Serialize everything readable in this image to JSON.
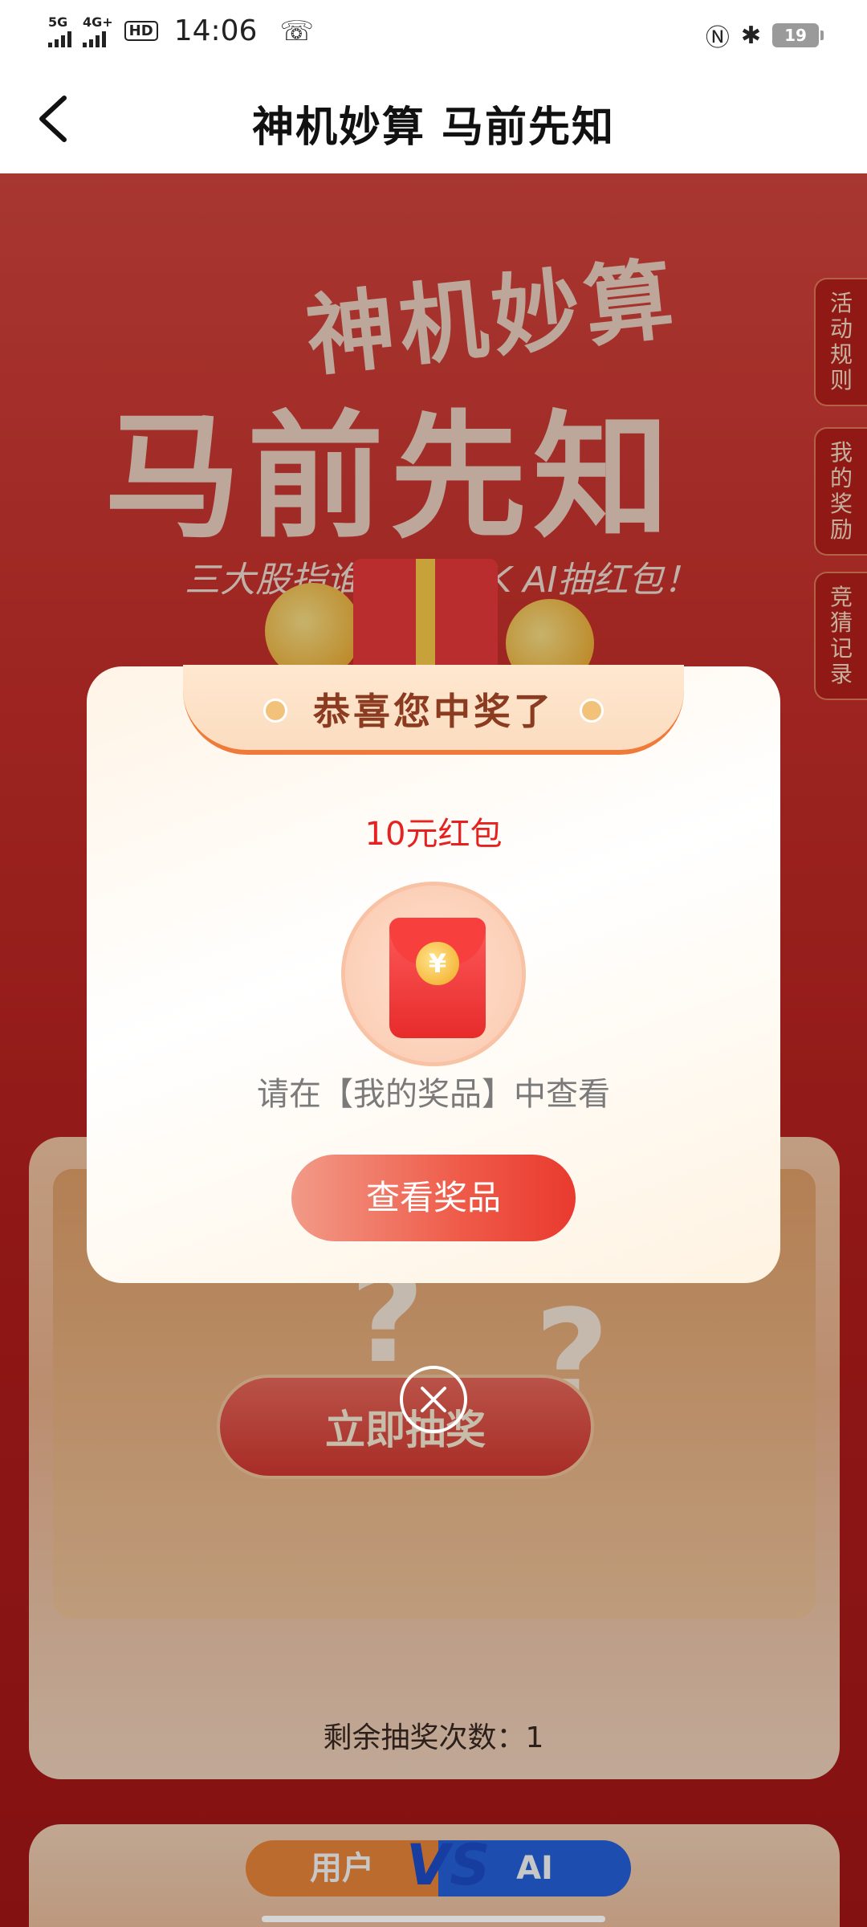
{
  "status_bar": {
    "network1": "5G",
    "network2": "4G+",
    "hd": "HD",
    "time": "14:06",
    "battery": "19",
    "icons": [
      "nfc-icon",
      "bluetooth-icon"
    ]
  },
  "nav": {
    "title": "神机妙算  马前先知"
  },
  "hero": {
    "title_top": "神机妙算",
    "title_bottom": "马前先知",
    "subtitle": "三大股指谁最牛？PK AI抽红包！"
  },
  "side_tabs": [
    "活动规则",
    "我的奖励",
    "竞猜记录"
  ],
  "lottery": {
    "draw_button": "立即抽奖",
    "remaining": "剩余抽奖次数：1"
  },
  "pk": {
    "user": "用户",
    "vs": "VS",
    "ai": "AI"
  },
  "modal": {
    "header": "恭喜您中奖了",
    "prize": "10元红包",
    "yen": "¥",
    "hint": "请在【我的奖品】中查看",
    "button": "查看奖品"
  }
}
